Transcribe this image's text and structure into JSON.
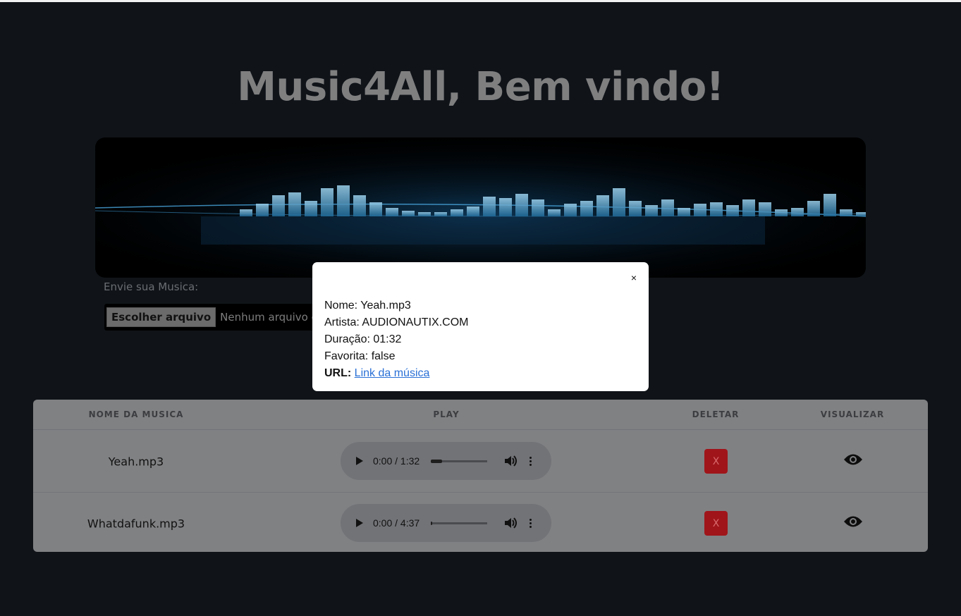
{
  "header": {
    "title": "Music4All, Bem vindo!"
  },
  "upload": {
    "label": "Envie sua Musica:",
    "button_label": "Escolher arquivo",
    "status": "Nenhum arquivo esc"
  },
  "table": {
    "columns": [
      "NOME DA MUSICA",
      "PLAY",
      "DELETAR",
      "VISUALIZAR"
    ],
    "rows": [
      {
        "name": "Yeah.mp3",
        "time": "0:00 / 1:32",
        "progress": 0.2,
        "delete_label": "X",
        "view_icon": "eye-icon"
      },
      {
        "name": "Whatdafunk.mp3",
        "time": "0:00 / 4:37",
        "progress": 0.0,
        "delete_label": "X",
        "view_icon": "eye-icon"
      }
    ]
  },
  "modal": {
    "close_label": "×",
    "nome": "Nome: Yeah.mp3",
    "artista": "Artista: AUDIONAUTIX.COM",
    "duracao": "Duração: 01:32",
    "favorita": "Favorita: false",
    "url_label": "URL:",
    "url_link_text": "Link da música"
  },
  "colors": {
    "background": "#101419",
    "title": "#7f7f80",
    "delete_button": "#a0151a",
    "link": "#2a70d6"
  }
}
